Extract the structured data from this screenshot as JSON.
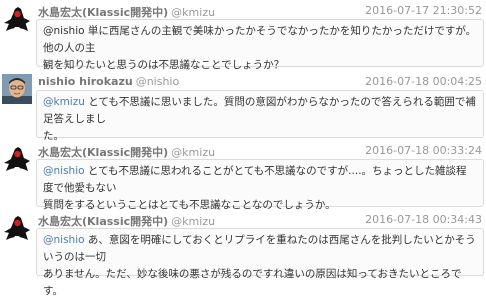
{
  "tweets": [
    {
      "author": "水島宏太(Klassic開発中)",
      "handle": "@kmizu",
      "time": "2016-07-17 21:30:52",
      "avatar": "duke-icon",
      "mention": "",
      "text_line1": "@nishio 単に西尾さんの主観で美味かったかそうでなかったかを知りたかっただけですが。他の人の主",
      "text_line2": "観を知りたいと思うのは不思議なことでしょうか？"
    },
    {
      "author": "nishio hirokazu",
      "handle": "@nishio",
      "time": "2016-07-18 00:04:25",
      "avatar": "photo-avatar-icon",
      "mention": "@kmizu",
      "text_line1": " とても不思議に思いました。質問の意図がわからなかったので答えられる範囲で補足答えしまし",
      "text_line2": "た。"
    },
    {
      "author": "水島宏太(Klassic開発中)",
      "handle": "@kmizu",
      "time": "2016-07-18 00:33:24",
      "avatar": "duke-icon",
      "mention": "@nishio",
      "text_line1": " とても不思議に思われることがとても不思議なのですが....。ちょっとした雑談程度で他愛もない",
      "text_line2": "質問をするということはとても不思議なことなのでしょうか。"
    },
    {
      "author": "水島宏太(Klassic開発中)",
      "handle": "@kmizu",
      "time": "2016-07-18 00:34:43",
      "avatar": "duke-icon",
      "mention": "@nishio",
      "text_line1": " あ、意図を明確にしておくとリプライを重ねたのは西尾さんを批判したいとかそういうのは一切",
      "text_line2": "ありません。ただ、妙な後味の悪さが残るのですれ違いの原因は知っておきたいところです。"
    }
  ]
}
